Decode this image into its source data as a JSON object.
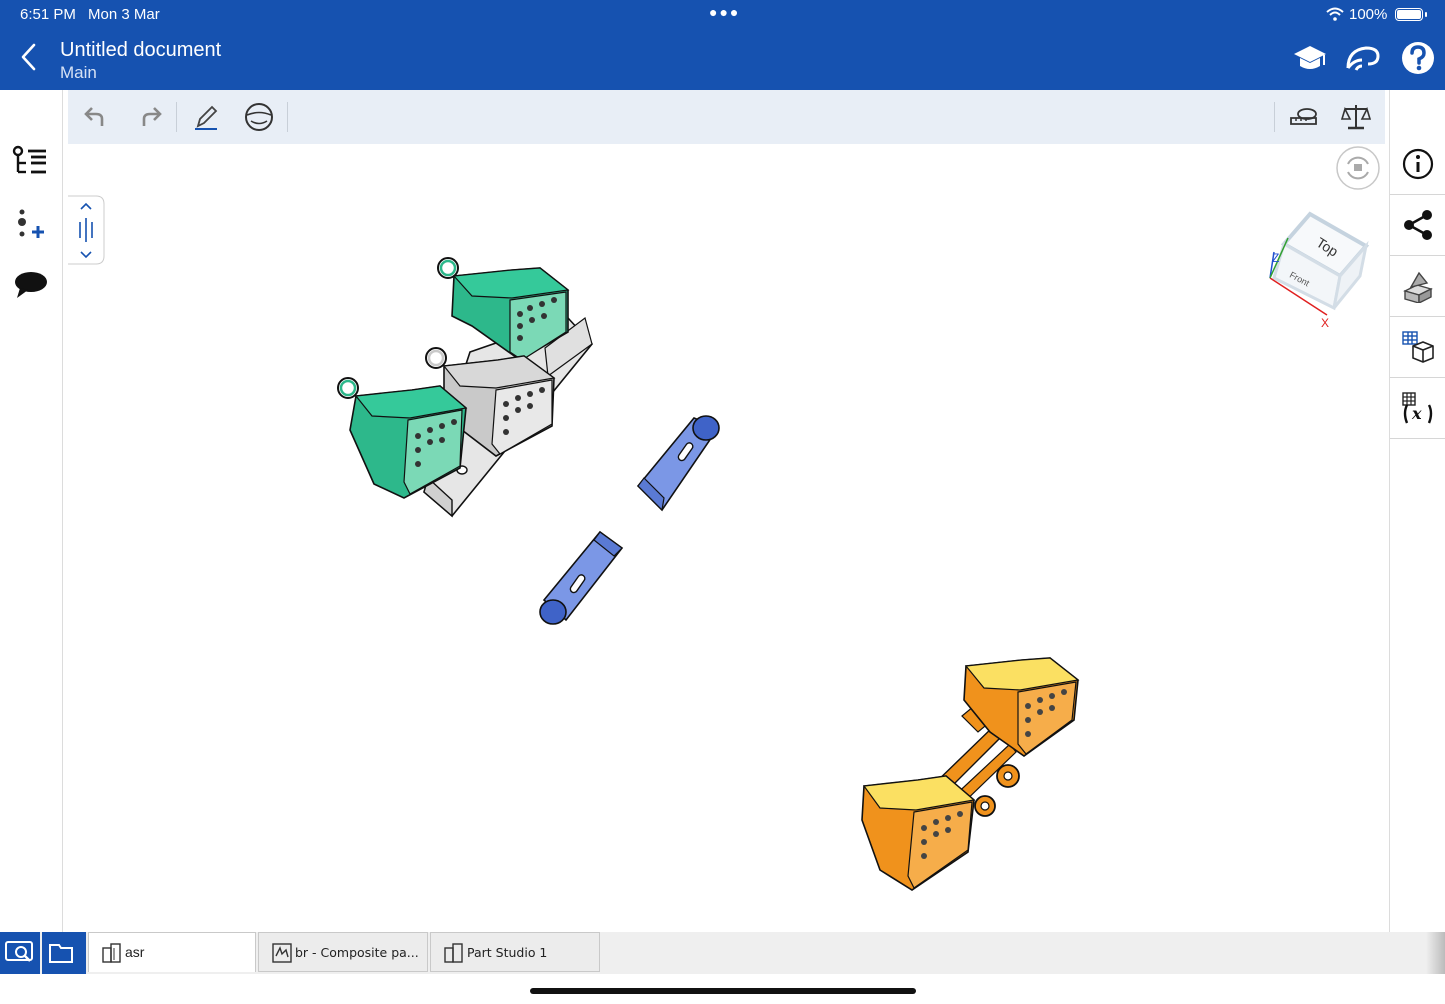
{
  "status_bar": {
    "time": "6:51 PM",
    "date": "Mon 3 Mar",
    "battery": "100%"
  },
  "header": {
    "title": "Untitled document",
    "subtitle": "Main",
    "icons": [
      "learning-center-icon",
      "connect-icon",
      "help-icon"
    ]
  },
  "left_panel": {
    "icons": [
      "feature-tree-icon",
      "add-instance-icon",
      "comments-icon"
    ]
  },
  "toolbar": {
    "left_icons": [
      "undo-icon",
      "redo-icon",
      "sketch-icon",
      "view-icon"
    ],
    "right_icons": [
      "measure-icon",
      "mass-properties-icon"
    ]
  },
  "view_cube": {
    "top_label": "Top",
    "front_label": "Front",
    "axis_z": "Z",
    "axis_x": "X"
  },
  "right_panel": {
    "icons": [
      "info-icon",
      "share-icon",
      "appearance-icon",
      "configurations-icon",
      "variables-icon"
    ]
  },
  "tabs": [
    {
      "label": "asr",
      "icon": "assembly-icon",
      "active": true
    },
    {
      "label": "br - Composite pa...",
      "icon": "part-studio-icon",
      "active": false
    },
    {
      "label": "Part Studio 1",
      "icon": "part-studio-icon",
      "active": false
    }
  ],
  "colors": {
    "accent": "#1652b0",
    "green_part": "#2db88b",
    "grey_part": "#c9c9c9",
    "blue_part": "#7b97e6",
    "orange_part": "#f0921c",
    "yellow_face": "#fbe062"
  }
}
